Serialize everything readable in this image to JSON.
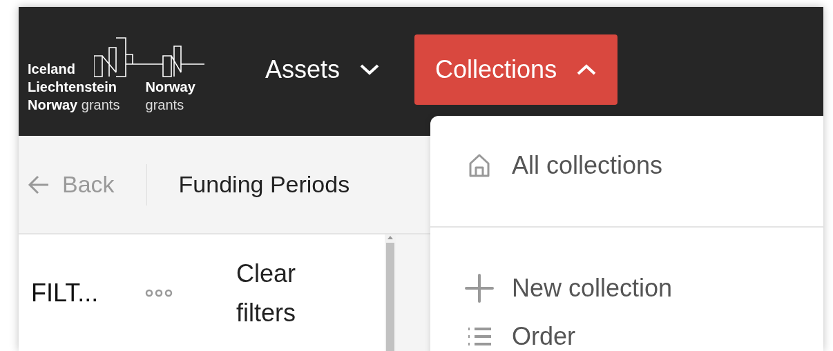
{
  "header": {
    "logo": {
      "left_lines": [
        {
          "text": "Iceland",
          "kind": "bold"
        },
        {
          "text": "Liechtenstein",
          "kind": "bold"
        },
        {
          "text": "**Norway** grants",
          "kind": "light"
        }
      ],
      "right_lines": [
        {
          "text": "Norway",
          "kind": "bold"
        },
        {
          "text": "grants",
          "kind": "light"
        }
      ]
    },
    "nav": [
      {
        "label": "Assets",
        "selected": false,
        "expanded": false
      },
      {
        "label": "Collections",
        "selected": true,
        "expanded": true
      }
    ]
  },
  "subheader": {
    "back": "Back",
    "title": "Funding Periods"
  },
  "filters": {
    "title": "FILT...",
    "clear": "Clear filters"
  },
  "menu": {
    "sections": [
      [
        {
          "label": "All collections",
          "kind": "home"
        }
      ],
      [
        {
          "label": "New collection",
          "kind": "plus"
        },
        {
          "label": "Order",
          "kind": "list"
        }
      ]
    ]
  }
}
